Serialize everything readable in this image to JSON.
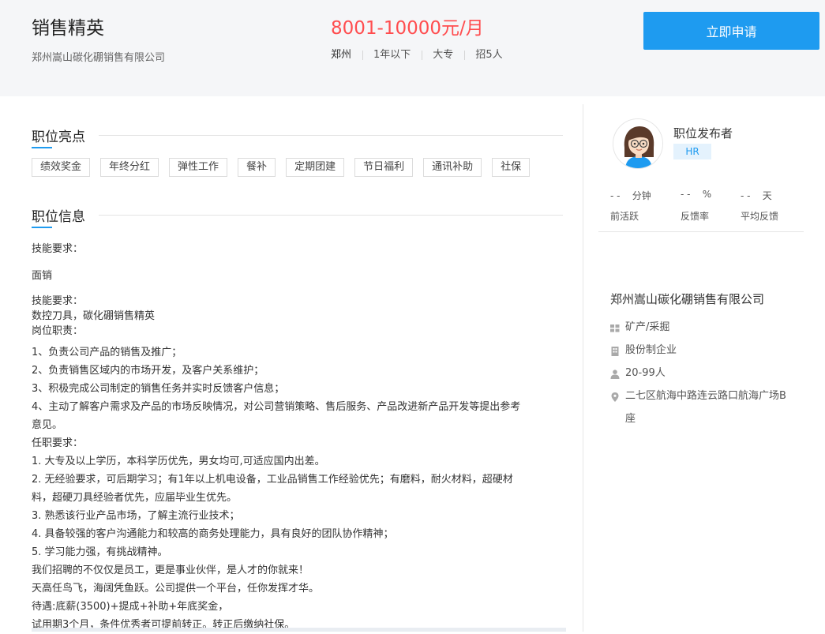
{
  "job": {
    "title": "销售精英",
    "company": "郑州嵩山碳化硼销售有限公司",
    "salary": "8001-10000元/月",
    "meta": [
      "郑州",
      "1年以下",
      "大专",
      "招5人"
    ],
    "apply_label": "立即申请"
  },
  "highlights": {
    "heading": "职位亮点",
    "tags": [
      "绩效奖金",
      "年终分红",
      "弹性工作",
      "餐补",
      "定期团建",
      "节日福利",
      "通讯补助",
      "社保"
    ]
  },
  "info": {
    "heading": "职位信息",
    "skills_label": "技能要求：",
    "skills_value": "面销",
    "lines_block": [
      "技能要求：",
      "数控刀具，碳化硼销售精英",
      "岗位职责："
    ],
    "lines": [
      "1、负责公司产品的销售及推广；",
      "2、负责销售区域内的市场开发，及客户关系维护；",
      "3、积极完成公司制定的销售任务并实时反馈客户信息；",
      "4、主动了解客户需求及产品的市场反映情况，对公司营销策略、售后服务、产品改进新产品开发等提出参考",
      "意见。",
      "任职要求：",
      "1. 大专及以上学历，本科学历优先，男女均可,可适应国内出差。",
      "2. 无经验要求，可后期学习；有1年以上机电设备，工业品销售工作经验优先；有磨料，耐火材料，超硬材",
      "料，超硬刀具经验者优先，应届毕业生优先。",
      "3. 熟悉该行业产品市场，了解主流行业技术；",
      "4. 具备较强的客户沟通能力和较高的商务处理能力，具有良好的团队协作精神；",
      "5. 学习能力强，有挑战精神。",
      "我们招聘的不仅仅是员工，更是事业伙伴，是人才的你就来！",
      "天高任鸟飞，海阔凭鱼跃。公司提供一个平台，任你发挥才华。",
      "待遇:底薪(3500)+提成+补助+年底奖金，",
      "试用期3个月，条件优秀者可提前转正。转正后缴纳社保。"
    ]
  },
  "publisher": {
    "title": "职位发布者",
    "badge": "HR",
    "stats": [
      {
        "value": "- -    分钟",
        "label": "前活跃"
      },
      {
        "value": "- -    %",
        "label": "反馈率"
      },
      {
        "value": "- -    天",
        "label": "平均反馈"
      }
    ]
  },
  "company_card": {
    "name": "郑州嵩山碳化硼销售有限公司",
    "industry": "矿产/采掘",
    "type": "股份制企业",
    "size": "20-99人",
    "address": "二七区航海中路连云路口航海广场B座",
    "address_l1": "二七区航海中路连云路口航海广场B",
    "address_l2": "座"
  },
  "colors": {
    "accent": "#1e9bf0",
    "salary": "#ff4d4f",
    "header_bg": "#f5f6f8"
  }
}
